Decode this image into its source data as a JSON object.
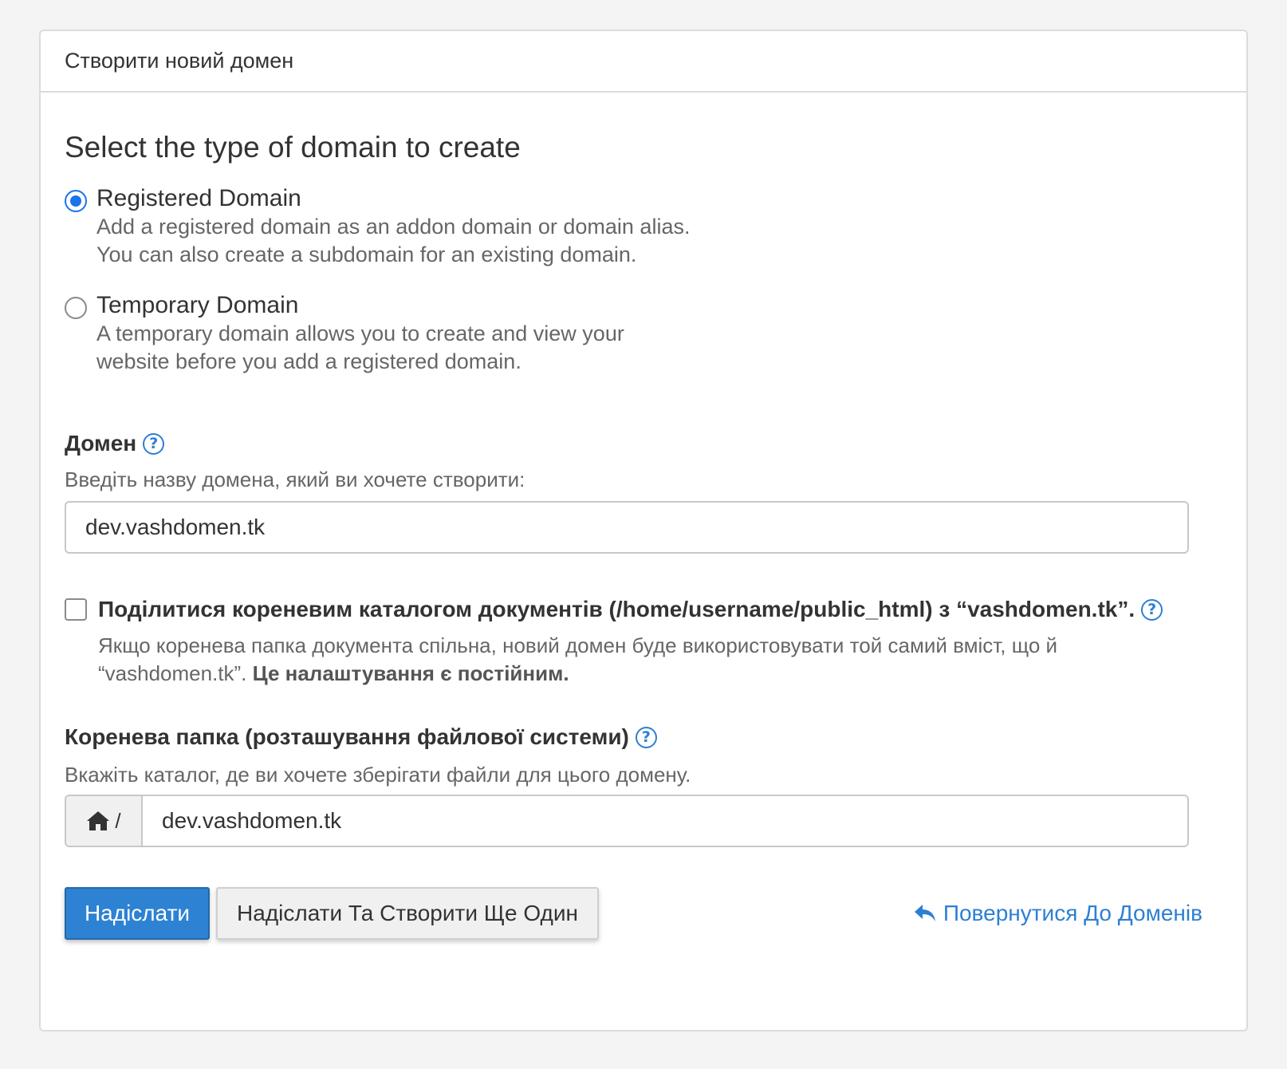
{
  "panel": {
    "title": "Створити новий домен"
  },
  "domain_type": {
    "title": "Select the type of domain to create",
    "options": [
      {
        "label": "Registered Domain",
        "desc_line1": "Add a registered domain as an addon domain or domain alias.",
        "desc_line2": "You can also create a subdomain for an existing domain.",
        "checked": true
      },
      {
        "label": "Temporary Domain",
        "desc_line1": "A temporary domain allows you to create and view your",
        "desc_line2": "website before you add a registered domain.",
        "checked": false
      }
    ]
  },
  "domain_field": {
    "label": "Домен",
    "hint": "Введіть назву домена, який ви хочете створити:",
    "value": "dev.vashdomen.tk"
  },
  "share_docroot": {
    "label": "Поділитися кореневим каталогом документів (/home/username/public_html) з “vashdomen.tk”.",
    "desc_line1": "Якщо коренева папка документа спільна, новий домен буде використовувати той самий вміст, що й",
    "desc_line2_prefix": "“vashdomen.tk”.",
    "desc_line2_bold": "Це налаштування є постійним.",
    "checked": false
  },
  "docroot_field": {
    "label": "Коренева папка (розташування файлової системи)",
    "hint": "Вкажіть каталог, де ви хочете зберігати файли для цього домену.",
    "prefix": "/",
    "value": "dev.vashdomen.tk"
  },
  "actions": {
    "submit": "Надіслати",
    "submit_another": "Надіслати Та Створити Ще Один",
    "back": "Повернутися До Доменів"
  },
  "colors": {
    "accent": "#2d82d3",
    "link": "#2d7fd3",
    "radio_checked": "#1a73e8"
  }
}
